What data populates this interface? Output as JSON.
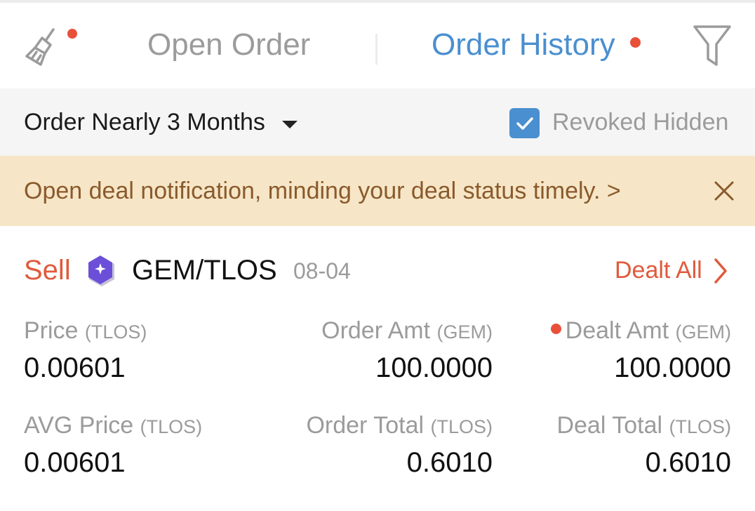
{
  "header": {
    "tabs": [
      {
        "label": "Open Order",
        "active": false
      },
      {
        "label": "Order History",
        "active": true,
        "has_dot": true
      }
    ],
    "left_icon": "broom-icon",
    "right_icon": "filter-icon"
  },
  "filters": {
    "range_label": "Order Nearly 3 Months",
    "revoked_hidden_label": "Revoked Hidden",
    "revoked_hidden_checked": true
  },
  "notice": {
    "text": "Open deal notification, minding your deal status timely. >"
  },
  "order": {
    "side": "Sell",
    "pair": "GEM/TLOS",
    "date": "08-04",
    "action_label": "Dealt All",
    "fields": {
      "price": {
        "label": "Price",
        "unit": "(TLOS)",
        "value": "0.00601"
      },
      "order_amt": {
        "label": "Order Amt",
        "unit": "(GEM)",
        "value": "100.0000"
      },
      "dealt_amt": {
        "label": "Dealt Amt",
        "unit": "(GEM)",
        "value": "100.0000"
      },
      "avg_price": {
        "label": "AVG Price",
        "unit": "(TLOS)",
        "value": "0.00601"
      },
      "order_total": {
        "label": "Order Total",
        "unit": "(TLOS)",
        "value": "0.6010"
      },
      "deal_total": {
        "label": "Deal Total",
        "unit": "(TLOS)",
        "value": "0.6010"
      }
    }
  },
  "colors": {
    "accent_blue": "#4a8fcf",
    "sell_red": "#e05a3c",
    "dot_red": "#e8503a",
    "notice_bg": "#f6e6c7",
    "notice_text": "#8a5a2c"
  }
}
